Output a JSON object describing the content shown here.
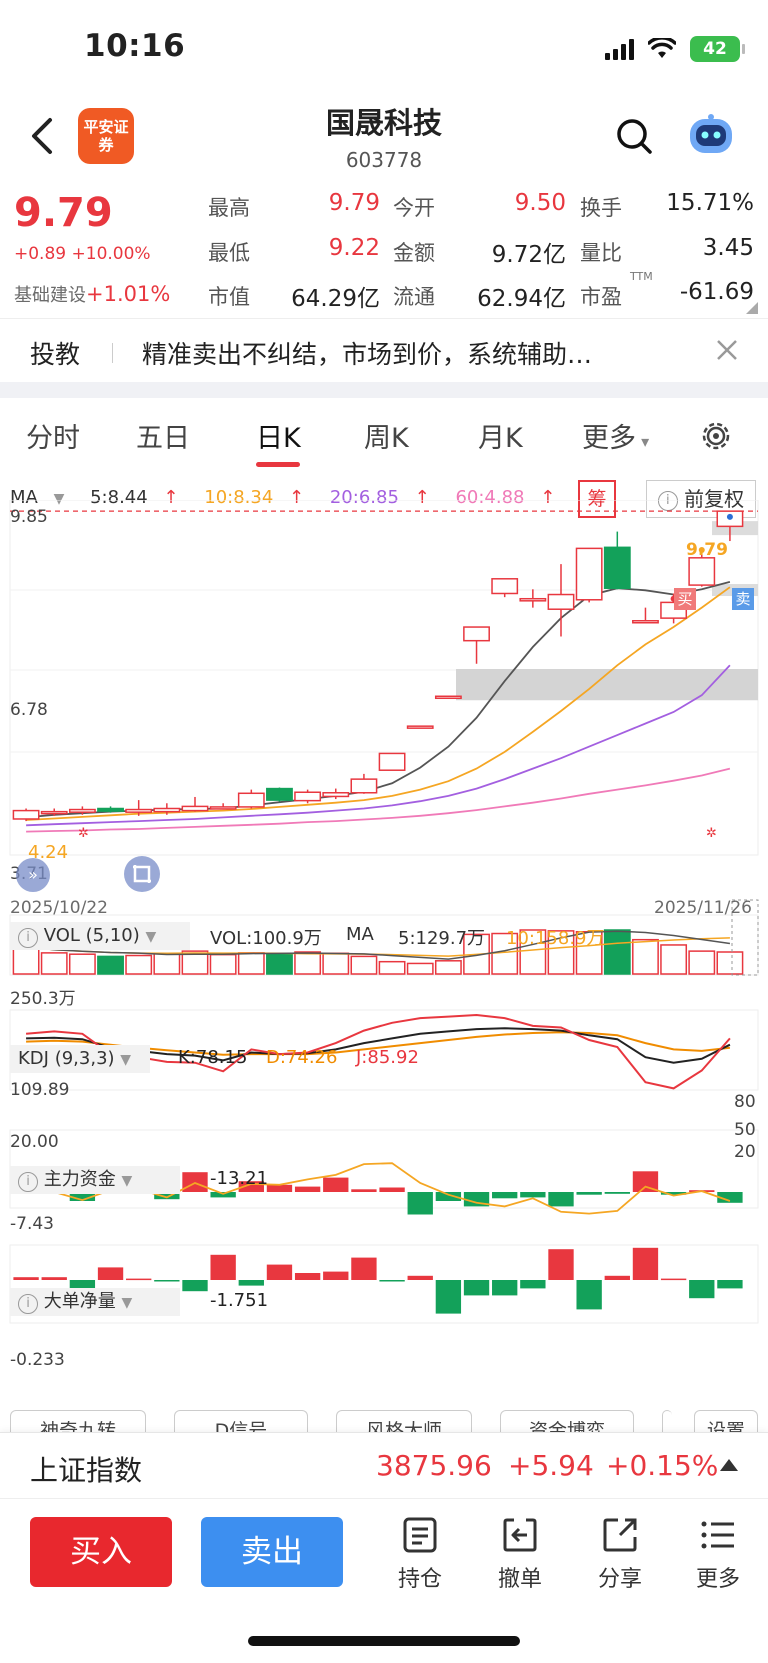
{
  "status": {
    "time": "10:16",
    "battery": "42"
  },
  "header": {
    "logo_text": "平安证券",
    "stock_name": "国晟科技",
    "stock_code": "603778"
  },
  "quote": {
    "price": "9.79",
    "change": "+0.89",
    "change_pct": "+10.00%",
    "sector_name": "基础建设",
    "sector_change": "+1.01%",
    "fields": [
      {
        "label": "最高",
        "value": "9.79"
      },
      {
        "label": "今开",
        "value": "9.50"
      },
      {
        "label": "换手",
        "value": "15.71%"
      },
      {
        "label": "最低",
        "value": "9.22"
      },
      {
        "label": "金额",
        "value": "9.72亿"
      },
      {
        "label": "量比",
        "value": "3.45"
      },
      {
        "label": "市值",
        "value": "64.29亿"
      },
      {
        "label": "流通",
        "value": "62.94亿"
      },
      {
        "label": "市盈",
        "value": "-61.69",
        "suffix": "TTM"
      }
    ]
  },
  "notice": {
    "tag": "投教",
    "text": "精准卖出不纠结，市场到价，系统辅助…"
  },
  "tabs": [
    {
      "label": "分时"
    },
    {
      "label": "五日"
    },
    {
      "label": "日K",
      "active": true
    },
    {
      "label": "周K"
    },
    {
      "label": "月K"
    },
    {
      "label": "更多"
    }
  ],
  "ma_legend": {
    "name": "MA",
    "ma5": "5:8.44",
    "ma10": "10:8.34",
    "ma20": "20:6.85",
    "ma60": "60:4.88",
    "chip_label": "筹",
    "adjust_label": "前复权"
  },
  "chart": {
    "y_top": "9.85",
    "y_mid": "6.78",
    "y_low_label": "4.24",
    "y_bottom_label": "3.71",
    "date_start": "2025/10/22",
    "date_end": "2025/11/26",
    "limit_label": "9.79",
    "buy_marker": "买",
    "sell_marker": "卖",
    "colors": {
      "up": "#e8373f",
      "down": "#13a15a",
      "ma5": "#555555",
      "ma10": "#f5a623",
      "ma20": "#a35fe0",
      "ma60": "#f07ab8"
    }
  },
  "chart_data": {
    "type": "candlestick",
    "dates_shown": [
      "2025/10/22",
      "2025/11/26"
    ],
    "ylim": [
      3.71,
      9.85
    ],
    "candles": [
      {
        "o": 3.92,
        "c": 4.08,
        "h": 4.12,
        "l": 3.88
      },
      {
        "o": 4.05,
        "c": 4.06,
        "h": 4.12,
        "l": 3.98
      },
      {
        "o": 4.05,
        "c": 4.1,
        "h": 4.16,
        "l": 4.0
      },
      {
        "o": 4.12,
        "c": 4.07,
        "h": 4.16,
        "l": 4.04
      },
      {
        "o": 4.05,
        "c": 4.1,
        "h": 4.28,
        "l": 3.98
      },
      {
        "o": 4.06,
        "c": 4.12,
        "h": 4.22,
        "l": 4.0
      },
      {
        "o": 4.08,
        "c": 4.16,
        "h": 4.34,
        "l": 4.06
      },
      {
        "o": 4.13,
        "c": 4.15,
        "h": 4.22,
        "l": 4.1
      },
      {
        "o": 4.15,
        "c": 4.41,
        "h": 4.48,
        "l": 4.12
      },
      {
        "o": 4.5,
        "c": 4.28,
        "h": 4.52,
        "l": 4.25
      },
      {
        "o": 4.27,
        "c": 4.43,
        "h": 4.48,
        "l": 4.22
      },
      {
        "o": 4.35,
        "c": 4.42,
        "h": 4.5,
        "l": 4.3
      },
      {
        "o": 4.42,
        "c": 4.68,
        "h": 4.78,
        "l": 4.4
      },
      {
        "o": 4.85,
        "c": 5.17,
        "h": 5.17,
        "l": 4.85
      },
      {
        "o": 5.69,
        "c": 5.69,
        "h": 5.69,
        "l": 5.69
      },
      {
        "o": 6.26,
        "c": 6.26,
        "h": 6.26,
        "l": 6.26
      },
      {
        "o": 7.32,
        "c": 7.58,
        "h": 7.58,
        "l": 6.88
      },
      {
        "o": 8.22,
        "c": 8.5,
        "h": 8.5,
        "l": 8.15
      },
      {
        "o": 8.08,
        "c": 8.12,
        "h": 8.3,
        "l": 7.95
      },
      {
        "o": 7.92,
        "c": 8.2,
        "h": 8.78,
        "l": 7.4
      },
      {
        "o": 8.1,
        "c": 9.08,
        "h": 9.08,
        "l": 8.05
      },
      {
        "o": 9.1,
        "c": 8.32,
        "h": 9.4,
        "l": 8.3
      },
      {
        "o": 7.68,
        "c": 7.7,
        "h": 7.95,
        "l": 7.65
      },
      {
        "o": 7.75,
        "c": 8.05,
        "h": 8.22,
        "l": 7.65
      },
      {
        "o": 8.38,
        "c": 8.9,
        "h": 8.98,
        "l": 8.35
      },
      {
        "o": 9.5,
        "c": 9.79,
        "h": 9.79,
        "l": 9.22
      }
    ],
    "ma5": [
      3.95,
      4.0,
      4.03,
      4.06,
      4.08,
      4.1,
      4.11,
      4.12,
      4.18,
      4.24,
      4.3,
      4.36,
      4.44,
      4.6,
      4.9,
      5.3,
      5.85,
      6.55,
      7.2,
      7.75,
      8.18,
      8.32,
      8.28,
      8.2,
      8.3,
      8.44
    ],
    "ma10": [
      3.9,
      3.93,
      3.96,
      3.99,
      4.02,
      4.04,
      4.06,
      4.08,
      4.11,
      4.15,
      4.19,
      4.23,
      4.28,
      4.36,
      4.48,
      4.64,
      4.88,
      5.2,
      5.58,
      5.98,
      6.4,
      6.85,
      7.25,
      7.58,
      7.95,
      8.34
    ],
    "ma20": [
      3.8,
      3.82,
      3.84,
      3.86,
      3.88,
      3.9,
      3.92,
      3.95,
      3.98,
      4.01,
      4.04,
      4.08,
      4.12,
      4.18,
      4.26,
      4.36,
      4.5,
      4.68,
      4.88,
      5.08,
      5.3,
      5.52,
      5.74,
      5.96,
      6.28,
      6.85
    ],
    "ma60": [
      3.68,
      3.69,
      3.7,
      3.72,
      3.73,
      3.75,
      3.77,
      3.79,
      3.81,
      3.83,
      3.86,
      3.88,
      3.91,
      3.94,
      3.98,
      4.03,
      4.09,
      4.16,
      4.23,
      4.31,
      4.4,
      4.48,
      4.56,
      4.65,
      4.75,
      4.88
    ]
  },
  "volume": {
    "head": "VOL (5,10)",
    "value_label": "VOL:100.9万",
    "ma_label": "MA",
    "ma5_label": "5:129.7万",
    "ma10_label": "10:158.9万",
    "y_label": "250.3万",
    "bars": [
      62,
      48,
      45,
      40,
      42,
      46,
      52,
      44,
      48,
      44,
      50,
      47,
      40,
      28,
      24,
      30,
      90,
      92,
      100,
      98,
      96,
      100,
      78,
      66,
      52,
      50
    ]
  },
  "kdj": {
    "head": "KDJ (9,3,3)",
    "k_label": "K:78.15",
    "d_label": "D:74.26",
    "j_label": "J:85.92",
    "y_top": "109.89",
    "y_bottom": "20.00",
    "right_ticks": [
      "80",
      "50",
      "20"
    ],
    "k": [
      86,
      87,
      85,
      74,
      70,
      66,
      64,
      58,
      68,
      66,
      67,
      72,
      80,
      86,
      92,
      95,
      98,
      99,
      98,
      96,
      90,
      85,
      62,
      55,
      60,
      78
    ],
    "d": [
      82,
      83,
      82,
      78,
      74,
      71,
      68,
      65,
      66,
      66,
      66,
      68,
      72,
      76,
      80,
      84,
      88,
      91,
      93,
      94,
      93,
      90,
      80,
      72,
      70,
      74
    ],
    "j": [
      92,
      95,
      92,
      66,
      62,
      56,
      55,
      44,
      72,
      66,
      68,
      80,
      96,
      106,
      112,
      114,
      116,
      112,
      102,
      100,
      84,
      75,
      30,
      22,
      45,
      86
    ]
  },
  "main_fund": {
    "head": "主力资金",
    "value": "-13.21",
    "y_label": "-7.43",
    "bars": [
      0.1,
      0.3,
      -1.0,
      1.0,
      0.2,
      -0.8,
      2.2,
      -0.6,
      1.2,
      0.8,
      0.6,
      1.6,
      0.3,
      0.5,
      -2.5,
      -1.0,
      -1.6,
      -0.7,
      -0.6,
      -1.6,
      -0.3,
      -0.2,
      2.3,
      -0.3,
      0.2,
      -1.2
    ],
    "line": [
      0.1,
      0.0,
      -0.9,
      0.2,
      0.3,
      -0.6,
      1.0,
      -0.2,
      0.9,
      0.8,
      1.4,
      1.9,
      3.1,
      3.2,
      1.0,
      -0.3,
      -1.2,
      -1.6,
      -0.7,
      -2.2,
      -2.4,
      -2.1,
      0.6,
      -0.4,
      0.1,
      -1.0
    ]
  },
  "big_order": {
    "head": "大单净量",
    "value": "-1.751",
    "y_label": "-0.233",
    "bars": [
      0.2,
      0.2,
      -0.8,
      0.9,
      0.1,
      -0.1,
      -0.8,
      1.8,
      -0.4,
      1.1,
      0.5,
      0.6,
      1.6,
      -0.1,
      0.3,
      -2.4,
      -1.1,
      -1.1,
      -0.6,
      2.2,
      -2.1,
      0.3,
      2.3,
      0.1,
      -1.3,
      -0.6
    ]
  },
  "tools": [
    "神奇九转",
    "D信号",
    "风格大师",
    "资金博弈",
    "",
    "设置"
  ],
  "index_bar": {
    "name": "上证指数",
    "value": "3875.96",
    "change": "+5.94",
    "change_pct": "+0.15%"
  },
  "bottom_nav": {
    "buy": "买入",
    "sell": "卖出",
    "items": [
      {
        "label": "持仓",
        "icon": "holdings-icon"
      },
      {
        "label": "撤单",
        "icon": "cancel-order-icon"
      },
      {
        "label": "分享",
        "icon": "share-icon"
      },
      {
        "label": "更多",
        "icon": "more-icon"
      }
    ]
  }
}
